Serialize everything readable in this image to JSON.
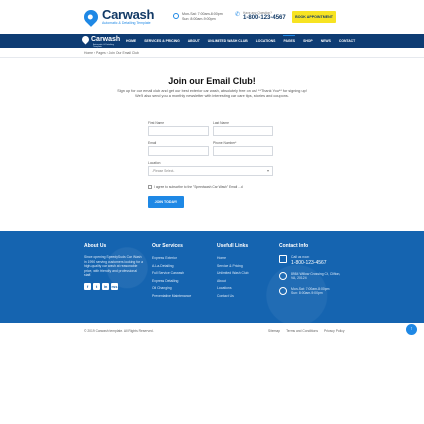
{
  "header": {
    "logo": {
      "name": "Carwash",
      "tagline": "Automatic & Detailing Template"
    },
    "hours": {
      "line1": "Mon-Sat: 7:00am-8:00pm",
      "line2": "Sun: 8:00am-9:00pm"
    },
    "phone": {
      "label": "Have any Question?",
      "number": "1-800-123-4567"
    },
    "book_label": "BOOK APPOINTMENT"
  },
  "nav": {
    "logo": {
      "name": "Carwash",
      "tagline": "Automatic & Detailing Template"
    },
    "items": [
      "HOME",
      "SERVICES & PRICING",
      "ABOUT",
      "UNLIMITED WASH CLUB",
      "LOCATIONS",
      "PAGES",
      "SHOP",
      "NEWS",
      "CONTACT"
    ],
    "active_index": 5
  },
  "breadcrumb": "Home › Pages › Join Our Email Club",
  "form": {
    "title": "Join our Email Club!",
    "intro": "Sign up for our email club and get our best exterior car wash, absolutely free on us! **Thank You** for signing up! We'll also send you a monthly newsletter with interesting car care tips, stories and coupons.",
    "first_name_label": "First Name",
    "last_name_label": "Last Name",
    "email_label": "Email",
    "phone_label": "Phone Number*",
    "location_label": "Location",
    "location_value": "-Please Select-",
    "agree_label": "I agree to subscribe to the \"Speedwash Car Wash\" Email ...d",
    "submit_label": "JOIN TODAY!"
  },
  "footer": {
    "about": {
      "title": "About Us",
      "text": "Since opening SpeedySuds Car Wash in 1990 serving customers looking for a high-quality car wash at reasonable price, with friendly and professional staff.",
      "social": [
        "f",
        "t",
        "in",
        "rss"
      ]
    },
    "services": {
      "title": "Our Services",
      "items": [
        "Express Exterior",
        "A-La-Detailing",
        "Full Service Carwash",
        "Express Detailing",
        "Oil Changing",
        "Preventative Maintenance"
      ]
    },
    "links": {
      "title": "Usefull Links",
      "items": [
        "Home",
        "Service & Pricing",
        "Unlimited Wash Club",
        "About",
        "Locations",
        "Contact Us"
      ]
    },
    "contact": {
      "title": "Contact Info",
      "call_label": "Call us now:",
      "call_number": "1-800-123-4567",
      "address": "8984 Willow Crossing Ct, Clifton, VA, 20124",
      "hours1": "Mon-Sat: 7:00am-8:00pm",
      "hours2": "Sun: 8:00am-9:00pm"
    }
  },
  "bottom": {
    "copyright": "© 2019 Carwash template. All Rights Reserved.",
    "links": [
      "Sitemap",
      "Terms and Conditions",
      "Privacy Policy"
    ],
    "totop_icon": "↑"
  },
  "colors": {
    "primary": "#1e88e5",
    "navy": "#0e3c73",
    "footer": "#1564b0",
    "accent": "#f7e322"
  }
}
